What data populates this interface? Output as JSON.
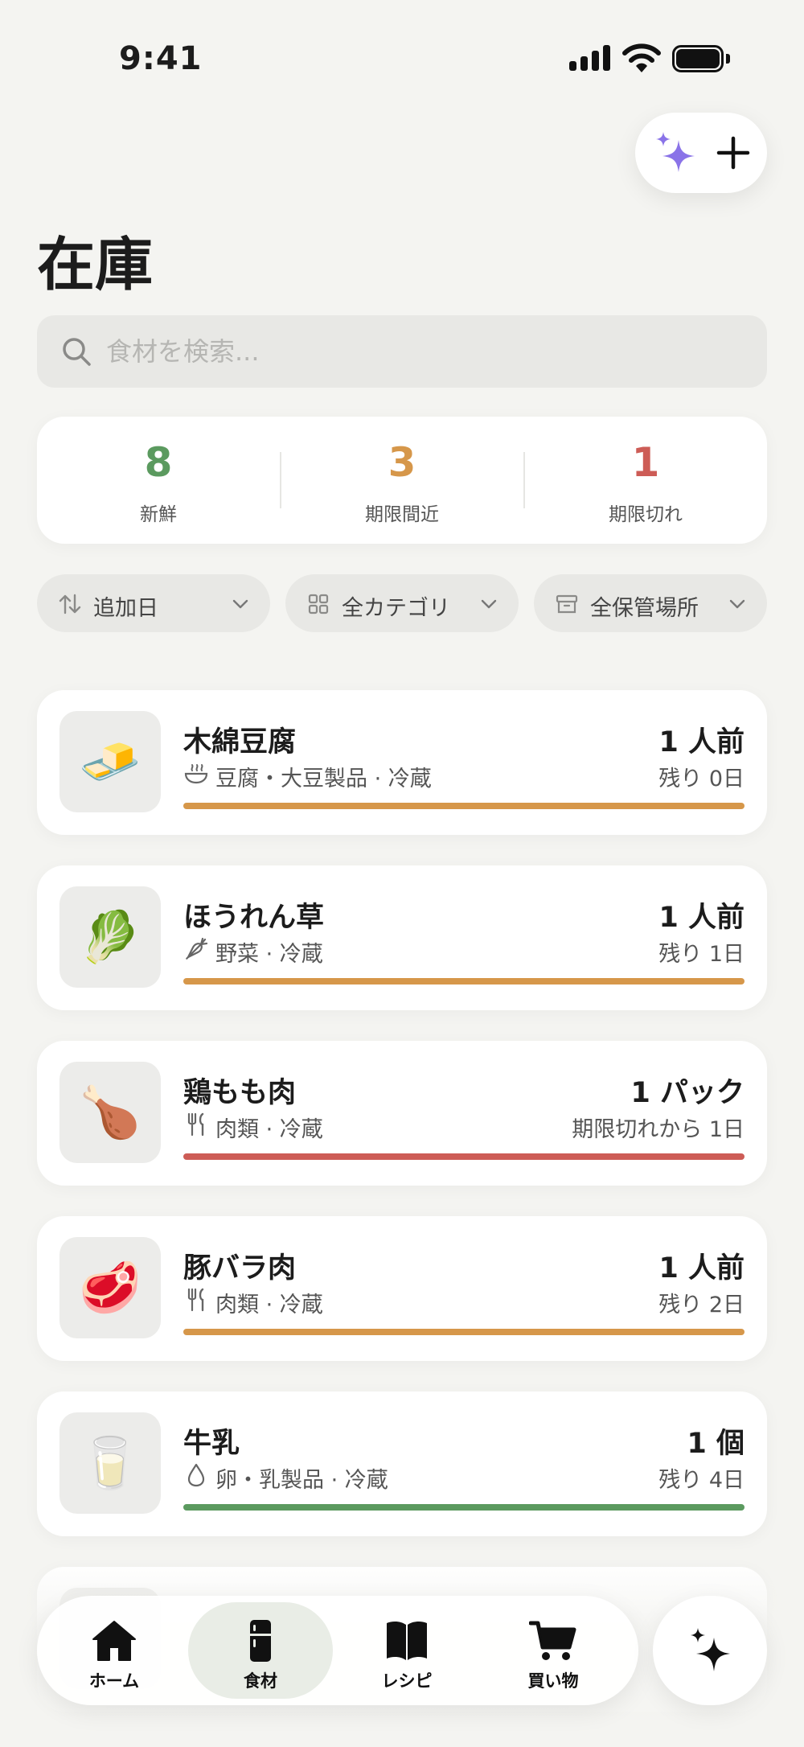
{
  "status_bar": {
    "time": "9:41"
  },
  "header": {
    "title": "在庫"
  },
  "search": {
    "placeholder": "食材を検索..."
  },
  "stats": [
    {
      "value": "8",
      "label": "新鮮",
      "color": "#5b9a5f"
    },
    {
      "value": "3",
      "label": "期限間近",
      "color": "#d6974a"
    },
    {
      "value": "1",
      "label": "期限切れ",
      "color": "#cd5c56"
    }
  ],
  "filters": {
    "sort": "追加日",
    "category": "全カテゴリ",
    "location": "全保管場所"
  },
  "items": [
    {
      "emoji": "🧈",
      "name": "木綿豆腐",
      "meta_icon": "bowl-icon",
      "meta": "豆腐・大豆製品 · 冷蔵",
      "qty": "1 人前",
      "remain": "残り 0日",
      "status": "expiring",
      "bar_color": "#d6974a"
    },
    {
      "emoji": "🥬",
      "name": "ほうれん草",
      "meta_icon": "carrot-icon",
      "meta": "野菜 · 冷蔵",
      "qty": "1 人前",
      "remain": "残り 1日",
      "status": "expiring",
      "bar_color": "#d6974a"
    },
    {
      "emoji": "🍗",
      "name": "鶏もも肉",
      "meta_icon": "fork-knife-icon",
      "meta": "肉類 · 冷蔵",
      "qty": "1 パック",
      "remain": "期限切れから 1日",
      "status": "expired",
      "bar_color": "#cd5c56"
    },
    {
      "emoji": "🥩",
      "name": "豚バラ肉",
      "meta_icon": "fork-knife-icon",
      "meta": "肉類 · 冷蔵",
      "qty": "1 人前",
      "remain": "残り 2日",
      "status": "expiring",
      "bar_color": "#d6974a"
    },
    {
      "emoji": "🥛",
      "name": "牛乳",
      "meta_icon": "drop-icon",
      "meta": "卵・乳製品 · 冷蔵",
      "qty": "1 個",
      "remain": "残り 4日",
      "status": "fresh",
      "bar_color": "#5b9a5f"
    }
  ],
  "tabs": [
    {
      "label": "ホーム",
      "icon": "home-icon"
    },
    {
      "label": "食材",
      "icon": "fridge-icon",
      "active": true
    },
    {
      "label": "レシピ",
      "icon": "book-icon"
    },
    {
      "label": "買い物",
      "icon": "cart-icon"
    }
  ],
  "colors": {
    "accent_purple": "#8a73e8",
    "fresh": "#5b9a5f",
    "expiring": "#d6974a",
    "expired": "#cd5c56"
  }
}
